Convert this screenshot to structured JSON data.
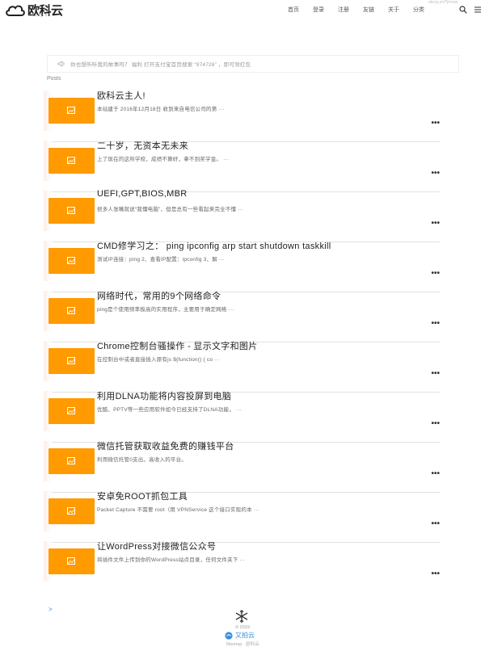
{
  "header": {
    "logo_text": "欧科云",
    "logo_sub": "okcxy.cn",
    "top_url": "okcxy.cn/?p=xxx",
    "nav": [
      "首页",
      "登录",
      "注册",
      "友链",
      "关于",
      "分类"
    ]
  },
  "notice": {
    "text": "你也想听听我的故事吗？ 福利 打开支付宝首页搜索 “974726” ，即可领红包"
  },
  "posts_heading": "Posts",
  "posts": [
    {
      "title": "欧科云主人!",
      "excerpt": "本站建于 2016年12月18日 收到来自电信公司的第 ···"
    },
    {
      "title": "二十岁，无资本无未来",
      "excerpt": "上了现在的这所学校，成绩不算好，拿不到奖学金。 ···"
    },
    {
      "title": "UEFI,GPT,BIOS,MBR",
      "excerpt": "很多人张嘴就说“我懂电脑”，但是总有一些看起来完全不懂 ···"
    },
    {
      "title": "CMD修学习之： ping ipconfig arp start shutdown taskkill",
      "excerpt": "测试IP连接：ping 2、查看IP配置：ipconfig 3、解 ···"
    },
    {
      "title": "网络时代，常用的9个网络命令",
      "excerpt": "ping是个使用频率极高的实用程序，主要用于确定网络 ···"
    },
    {
      "title": "Chrome控制台骚操作 - 显示文字和图片",
      "excerpt": "在控制台中或者直接插入原有js ${function() { co ···"
    },
    {
      "title": "利用DLNA功能将内容投屏到电脑",
      "excerpt": "优酷、PPTV等一些应用软件如今已经支持了DLNA功能， ···"
    },
    {
      "title": "微信托管获取收益免费的赚钱平台",
      "excerpt": "利用微信托管0支出，高收入的平台。"
    },
    {
      "title": "安卓免ROOT抓包工具",
      "excerpt": "Packet Capture 不需要 root（用 VPNService 这个接口实现的本 ···"
    },
    {
      "title": "让WordPress对接微信公众号",
      "excerpt": "将插件文件上传到你的WordPress站点目录，任何文件夹下 ···"
    }
  ],
  "more_label": "•••",
  "footer": {
    "pager_arrow": ">",
    "copyright": "© 2019",
    "brand": "又拍云",
    "sitemap": "Sitemap · 欧科云"
  },
  "colors": {
    "thumb": "#ff9a00",
    "brand_blue": "#3a8fdc",
    "link": "#4a7bd0"
  }
}
